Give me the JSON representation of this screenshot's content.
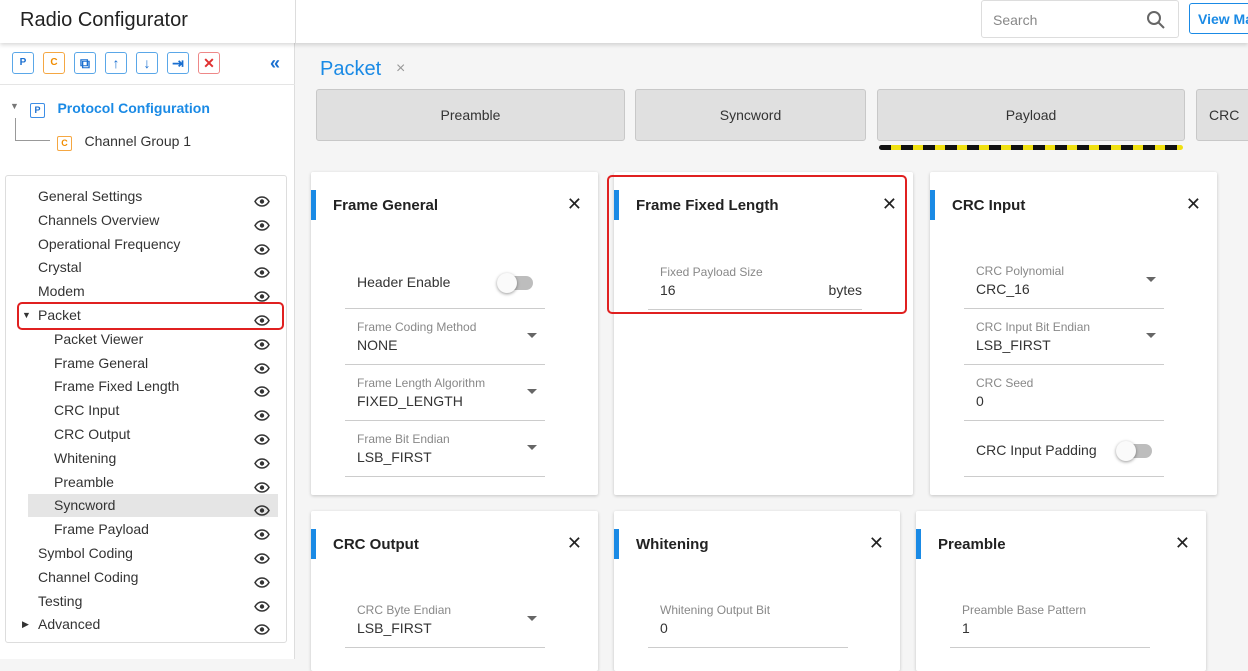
{
  "header": {
    "title": "Radio Configurator",
    "search_placeholder": "Search",
    "view_button": "View Ma"
  },
  "toolbar": {
    "buttons": [
      {
        "name": "add-protocol",
        "glyph": "P"
      },
      {
        "name": "add-channel-group",
        "glyph": "C"
      },
      {
        "name": "copy",
        "glyph": "⧉"
      },
      {
        "name": "move-up",
        "glyph": "↑"
      },
      {
        "name": "move-down",
        "glyph": "↓"
      },
      {
        "name": "import",
        "glyph": "⇥"
      },
      {
        "name": "delete",
        "glyph": "✕"
      }
    ],
    "collapse": "«"
  },
  "tree": {
    "root": {
      "badge": "P",
      "label": "Protocol Configuration"
    },
    "child": {
      "badge": "C",
      "label": "Channel Group 1"
    }
  },
  "nav": {
    "items": [
      {
        "label": "General Settings"
      },
      {
        "label": "Channels Overview"
      },
      {
        "label": "Operational Frequency"
      },
      {
        "label": "Crystal"
      },
      {
        "label": "Modem"
      },
      {
        "label": "Packet",
        "expanded": true,
        "highlighted": true
      },
      {
        "label": "Packet Viewer",
        "sub": true
      },
      {
        "label": "Frame General",
        "sub": true
      },
      {
        "label": "Frame Fixed Length",
        "sub": true
      },
      {
        "label": "CRC Input",
        "sub": true
      },
      {
        "label": "CRC Output",
        "sub": true
      },
      {
        "label": "Whitening",
        "sub": true
      },
      {
        "label": "Preamble",
        "sub": true
      },
      {
        "label": "Syncword",
        "sub": true,
        "selected": true
      },
      {
        "label": "Frame Payload",
        "sub": true
      },
      {
        "label": "Symbol Coding"
      },
      {
        "label": "Channel Coding"
      },
      {
        "label": "Testing"
      },
      {
        "label": "Advanced",
        "collapsed": true
      }
    ]
  },
  "page": {
    "title": "Packet",
    "close": "×"
  },
  "tabs": [
    {
      "label": "Preamble"
    },
    {
      "label": "Syncword"
    },
    {
      "label": "Payload",
      "active": true
    },
    {
      "label": "CRC"
    }
  ],
  "cards": {
    "frame_general": {
      "title": "Frame General",
      "header_enable": "Header Enable",
      "header_enable_on": false,
      "fields": [
        {
          "label": "Frame Coding Method",
          "value": "NONE"
        },
        {
          "label": "Frame Length Algorithm",
          "value": "FIXED_LENGTH"
        },
        {
          "label": "Frame Bit Endian",
          "value": "LSB_FIRST"
        }
      ]
    },
    "frame_fixed_length": {
      "title": "Frame Fixed Length",
      "field": {
        "label": "Fixed Payload Size",
        "value": "16",
        "unit": "bytes"
      }
    },
    "crc_input": {
      "title": "CRC Input",
      "fields": [
        {
          "label": "CRC Polynomial",
          "value": "CRC_16"
        },
        {
          "label": "CRC Input Bit Endian",
          "value": "LSB_FIRST"
        },
        {
          "label": "CRC Seed",
          "value": "0"
        }
      ],
      "padding": "CRC Input Padding",
      "padding_on": false
    },
    "crc_output": {
      "title": "CRC Output",
      "field": {
        "label": "CRC Byte Endian",
        "value": "LSB_FIRST"
      }
    },
    "whitening": {
      "title": "Whitening",
      "field": {
        "label": "Whitening Output Bit",
        "value": "0"
      }
    },
    "preamble": {
      "title": "Preamble",
      "field": {
        "label": "Preamble Base Pattern",
        "value": "1"
      }
    }
  },
  "colors": {
    "accent": "#1a8ae5",
    "highlight": "#e02020"
  }
}
